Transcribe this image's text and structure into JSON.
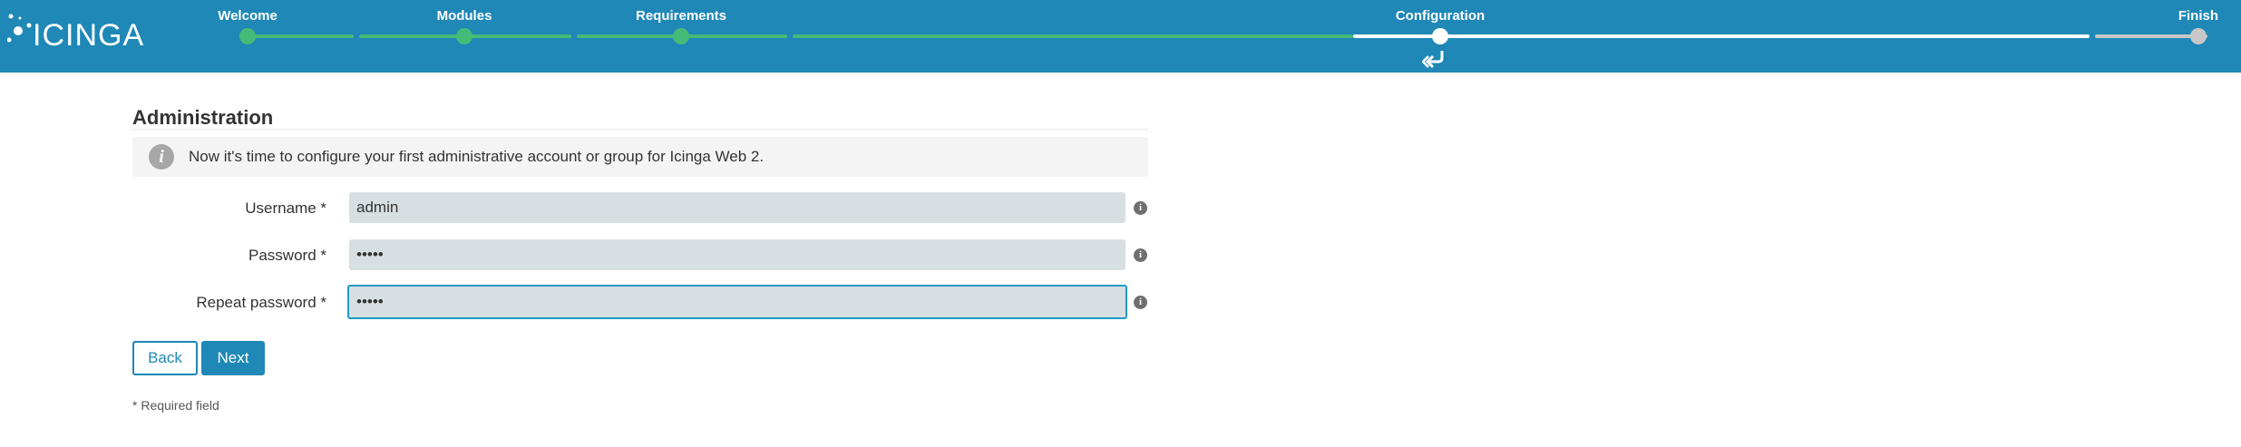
{
  "brand": {
    "name": "icinga"
  },
  "wizard": {
    "steps": [
      {
        "label": "Welcome",
        "state": "done"
      },
      {
        "label": "Modules",
        "state": "done"
      },
      {
        "label": "Requirements",
        "state": "done"
      },
      {
        "label": "Configuration",
        "state": "current"
      },
      {
        "label": "Finish",
        "state": "pending"
      }
    ]
  },
  "page": {
    "title": "Administration",
    "info": "Now it's time to configure your first administrative account or group for Icinga Web 2."
  },
  "form": {
    "username_label": "Username *",
    "username_value": "admin",
    "password_label": "Password *",
    "password_value": "admin",
    "repeat_password_label": "Repeat password *",
    "repeat_password_value": "admin"
  },
  "buttons": {
    "back": "Back",
    "next": "Next"
  },
  "footer": {
    "required_note": "* Required field"
  },
  "colors": {
    "header": "#1f88b7",
    "done": "#44bb77",
    "current": "#ffffff",
    "pending": "#c8c8c8",
    "input_bg": "#d8dfe2",
    "focus": "#1f9ac9"
  }
}
